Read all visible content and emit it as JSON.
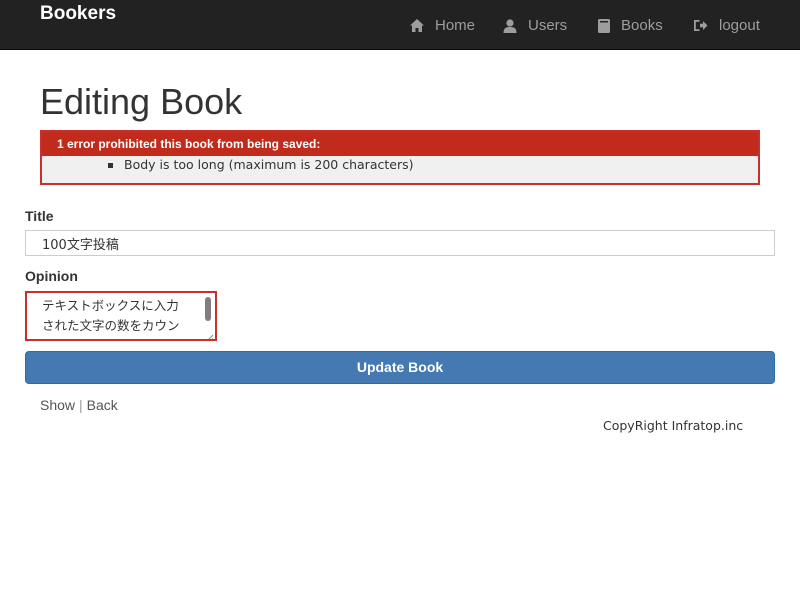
{
  "navbar": {
    "brand": "Bookers",
    "items": [
      {
        "label": "Home",
        "icon": "home-icon"
      },
      {
        "label": "Users",
        "icon": "user-icon"
      },
      {
        "label": "Books",
        "icon": "book-icon"
      },
      {
        "label": "logout",
        "icon": "logout-icon"
      }
    ]
  },
  "page": {
    "title": "Editing Book"
  },
  "errors": {
    "header": "1 error prohibited this book from being saved:",
    "messages": [
      "Body is too long (maximum is 200 characters)"
    ]
  },
  "form": {
    "title_label": "Title",
    "title_value": "100文字投稿",
    "opinion_label": "Opinion",
    "opinion_line_1": "テキストボックスに入力",
    "opinion_line_2": "された文字の数をカウン",
    "submit_label": "Update Book"
  },
  "links": {
    "show": "Show",
    "separator": "|",
    "back": "Back"
  },
  "footer": {
    "copyright": "CopyRight Infratop.inc"
  },
  "colors": {
    "navbar_bg": "#222222",
    "error_red": "#c02b1c",
    "button_blue": "#4479b1"
  }
}
